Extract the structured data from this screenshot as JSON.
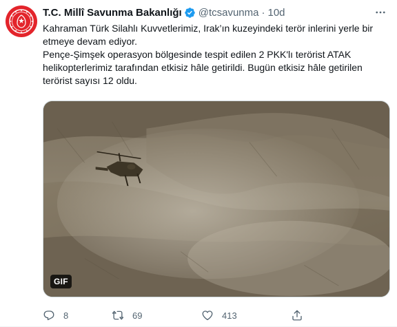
{
  "tweet": {
    "author_name": "T.C. Millî Savunma Bakanlığı",
    "handle": "@tcsavunma",
    "separator": "·",
    "time": "10d",
    "text_line_1": "Kahraman Türk Silahlı Kuvvetlerimiz, Irak’ın kuzeyindeki terör inlerini yerle bir etmeye devam ediyor.",
    "text_line_2": "Pençe-Şimşek operasyon bölgesinde tespit edilen 2 PKK'lı terörist ATAK helikopterlerimiz tarafından etkisiz hâle getirildi. Bugün etkisiz hâle getirilen terörist sayısı 12 oldu.",
    "media_badge": "GIF",
    "replies": "8",
    "retweets": "69",
    "likes": "413"
  },
  "icons": {
    "verified": "verified-badge-icon",
    "more": "more-icon",
    "reply": "reply-icon",
    "retweet": "retweet-icon",
    "like": "heart-icon",
    "share": "share-icon"
  },
  "colors": {
    "verified_blue": "#1d9bf0",
    "secondary_text": "#536471",
    "avatar_red": "#e3242b"
  }
}
